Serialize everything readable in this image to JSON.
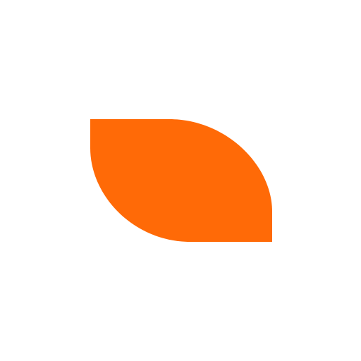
{
  "background_color": "#ffffff",
  "shape": {
    "icon": "leaf-petal-icon",
    "fill_color": "#ff6a07"
  }
}
